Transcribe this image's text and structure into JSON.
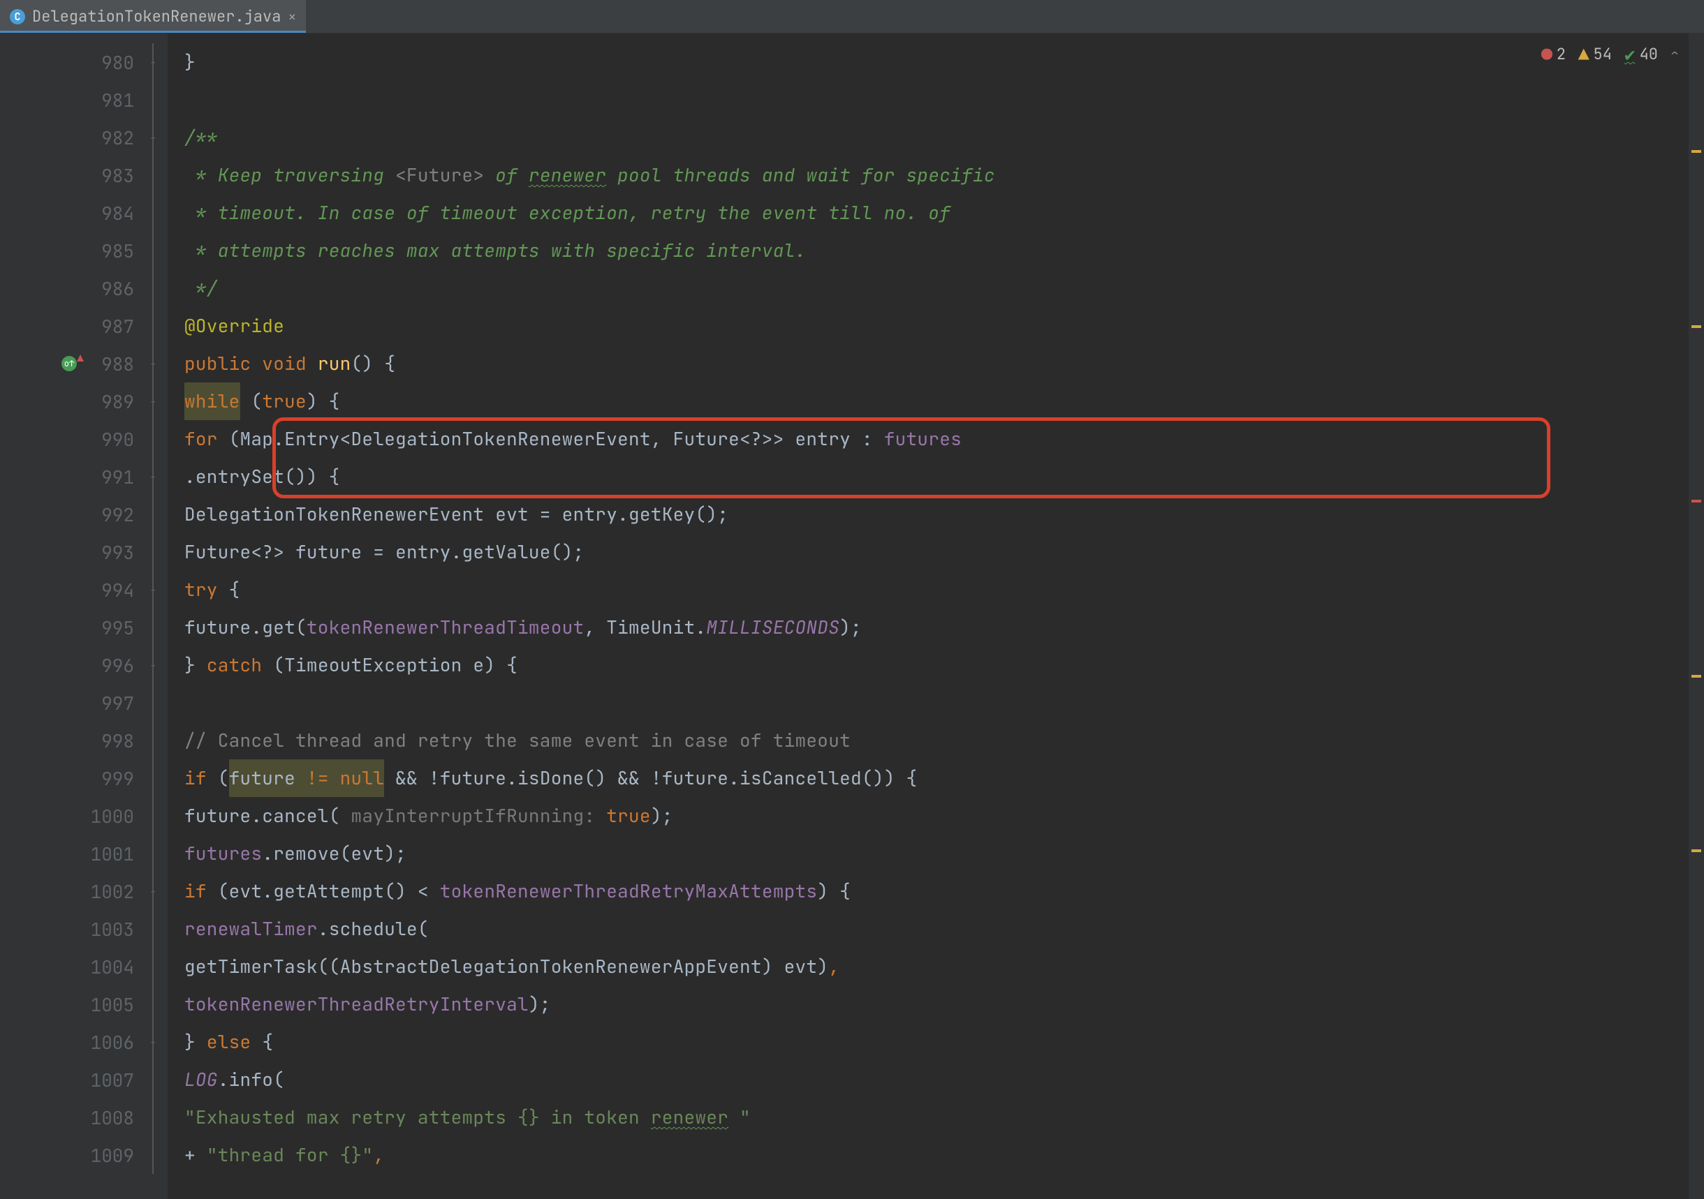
{
  "tab": {
    "filename": "DelegationTokenRenewer.java",
    "icon_letter": "C"
  },
  "inspections": {
    "errors": "2",
    "warnings": "54",
    "weak": "40"
  },
  "gutter_start": 980,
  "gutter_end": 1009,
  "lines": [
    {
      "n": 980,
      "fold": "up",
      "html": "      <span class='pun'>}</span>"
    },
    {
      "n": 981,
      "html": ""
    },
    {
      "n": 982,
      "fold": "down",
      "html": "      <span class='cmt'>/**</span>"
    },
    {
      "n": 983,
      "html": "      <span class='cmt'> * Keep traversing </span><span class='cmtg'>&lt;Future&gt;</span><span class='cmt'> of </span><span class='cmt wavy'>renewer</span><span class='cmt'> pool threads and wait for specific</span>"
    },
    {
      "n": 984,
      "html": "      <span class='cmt'> * timeout. In case of timeout exception, retry the event till no. of</span>"
    },
    {
      "n": 985,
      "html": "      <span class='cmt'> * attempts reaches max attempts with specific interval.</span>"
    },
    {
      "n": 986,
      "html": "      <span class='cmt'> */</span>"
    },
    {
      "n": 987,
      "html": "      <span class='ann'>@Override</span>"
    },
    {
      "n": 988,
      "icon": "override",
      "fold": "down",
      "html": "      <span class='kw'>public void </span><span class='mth'>run</span><span class='pun'>() {</span>"
    },
    {
      "n": 989,
      "fold": "down",
      "html": "        <span class='kw hlbg'>while</span><span class='pun'> (</span><span class='kw'>true</span><span class='pun'>) {</span>"
    },
    {
      "n": 990,
      "html": "          <span class='kw'>for </span><span class='pun'>(Map.Entry&lt;DelegationTokenRenewerEvent, Future&lt;?&gt;&gt; entry : </span><span class='fld'>futures</span>"
    },
    {
      "n": 991,
      "fold": "down",
      "html": "              <span class='pun'>.entrySet()) {</span>"
    },
    {
      "n": 992,
      "html": "            <span class='typ'>DelegationTokenRenewerEvent evt = entry.getKey();</span>"
    },
    {
      "n": 993,
      "html": "            <span class='typ'>Future&lt;?&gt; future = entry.getValue();</span>"
    },
    {
      "n": 994,
      "fold": "down",
      "html": "            <span class='kw'>try </span><span class='pun'>{</span>"
    },
    {
      "n": 995,
      "html": "              <span class='typ'>future.get(</span><span class='fld'>tokenRenewerThreadTimeout</span><span class='typ'>, TimeUnit.</span><span class='sta'>MILLISECONDS</span><span class='typ'>);</span>"
    },
    {
      "n": 996,
      "fold": "down",
      "html": "            <span class='pun'>} </span><span class='kw'>catch </span><span class='pun'>(TimeoutException e) {</span>"
    },
    {
      "n": 997,
      "html": ""
    },
    {
      "n": 998,
      "html": "              <span class='cmtg'>// Cancel thread and retry the same event in case of timeout</span>"
    },
    {
      "n": 999,
      "html": "              <span class='kw'>if </span><span class='pun'>(</span><span class='hlbg'><span class='typ'>future </span><span class='kw'>!= null</span></span><span class='pun'> &amp;&amp; !future.isDone() &amp;&amp; !future.isCancelled()) {</span>"
    },
    {
      "n": 1000,
      "html": "                <span class='typ'>future.cancel( </span><span class='greyital'>mayInterruptIfRunning: </span><span class='truelit'>true</span><span class='pun'>);</span>"
    },
    {
      "n": 1001,
      "html": "                <span class='fld'>futures</span><span class='typ'>.remove(evt);</span>"
    },
    {
      "n": 1002,
      "fold": "down",
      "html": "                <span class='kw'>if </span><span class='pun'>(evt.getAttempt() &lt; </span><span class='fld'>tokenRenewerThreadRetryMaxAttempts</span><span class='pun'>) {</span>"
    },
    {
      "n": 1003,
      "html": "                  <span class='fld'>renewalTimer</span><span class='typ'>.schedule(</span>"
    },
    {
      "n": 1004,
      "html": "                      <span class='typ'>getTimerTask((AbstractDelegationTokenRenewerAppEvent) evt)</span><span class='kw'>,</span>"
    },
    {
      "n": 1005,
      "html": "                      <span class='fld'>tokenRenewerThreadRetryInterval</span><span class='pun'>);</span>"
    },
    {
      "n": 1006,
      "fold": "up",
      "html": "                <span class='pun'>} </span><span class='kw'>else </span><span class='pun'>{</span>"
    },
    {
      "n": 1007,
      "html": "                  <span class='fldI'>LOG</span><span class='typ'>.info(</span>"
    },
    {
      "n": 1008,
      "html": "                      <span class='str'>\"Exhausted max retry attempts {} in token </span><span class='str wavy'>renewer</span><span class='str'> \"</span>"
    },
    {
      "n": 1009,
      "html": "                          <span class='pun'>+ </span><span class='str'>\"thread for {}\"</span><span class='kw'>,</span>"
    }
  ],
  "highlight_box": {
    "top_line": 990,
    "bottom_line": 991
  },
  "markers": [
    {
      "pct": 10,
      "type": "warn"
    },
    {
      "pct": 25,
      "type": "warn"
    },
    {
      "pct": 40,
      "type": "err"
    },
    {
      "pct": 55,
      "type": "warn"
    },
    {
      "pct": 70,
      "type": "warn"
    }
  ]
}
